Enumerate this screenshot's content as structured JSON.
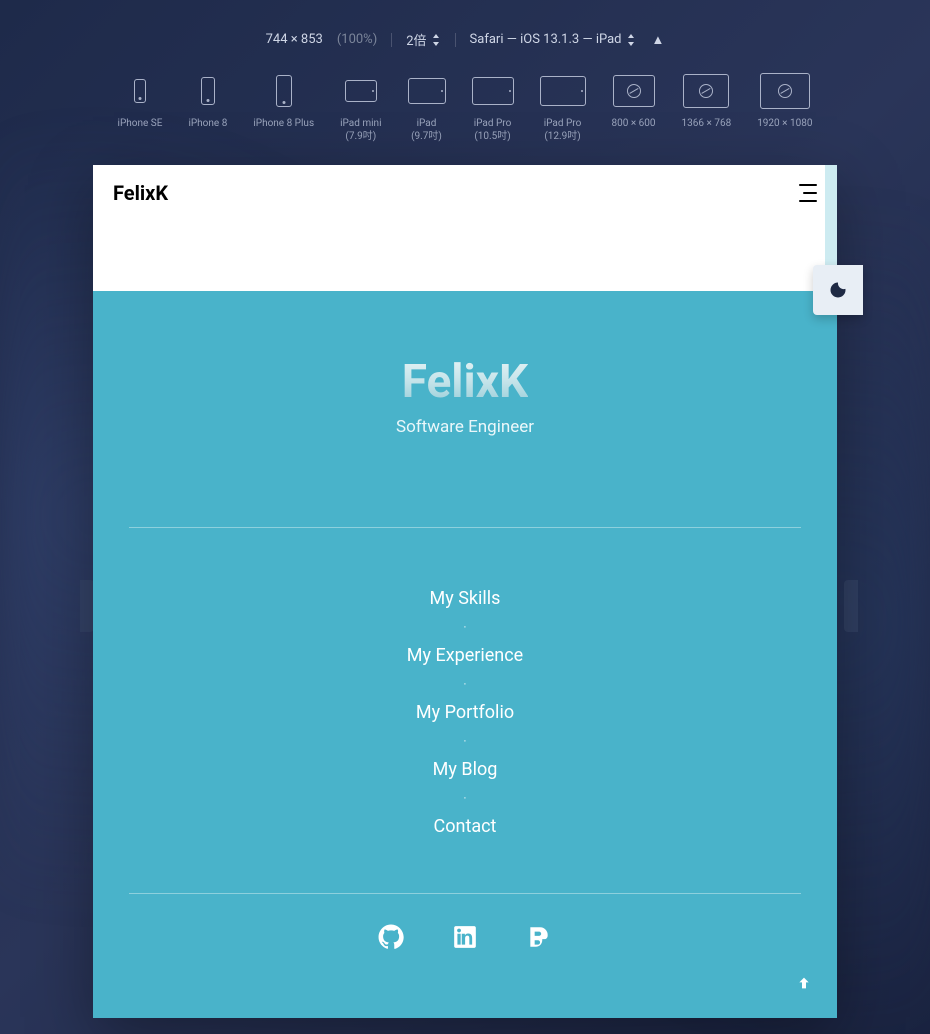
{
  "devtools": {
    "dimensions": "744 × 853",
    "zoom_pct": "(100%)",
    "scale": "2倍",
    "ua": "Safari — iOS 13.1.3 — iPad"
  },
  "devices": [
    {
      "name": "iPhone SE",
      "sub": ""
    },
    {
      "name": "iPhone 8",
      "sub": ""
    },
    {
      "name": "iPhone 8 Plus",
      "sub": ""
    },
    {
      "name": "iPad mini",
      "sub": "(7.9吋)"
    },
    {
      "name": "iPad",
      "sub": "(9.7吋)"
    },
    {
      "name": "iPad Pro",
      "sub": "(10.5吋)"
    },
    {
      "name": "iPad Pro",
      "sub": "(12.9吋)"
    },
    {
      "name": "800 × 600",
      "sub": ""
    },
    {
      "name": "1366 × 768",
      "sub": ""
    },
    {
      "name": "1920 × 1080",
      "sub": ""
    }
  ],
  "page": {
    "brand": "FelixK",
    "hero_title": "FelixK",
    "hero_sub": "Software Engineer",
    "nav": [
      "My Skills",
      "My Experience",
      "My Portfolio",
      "My Blog",
      "Contact"
    ]
  }
}
